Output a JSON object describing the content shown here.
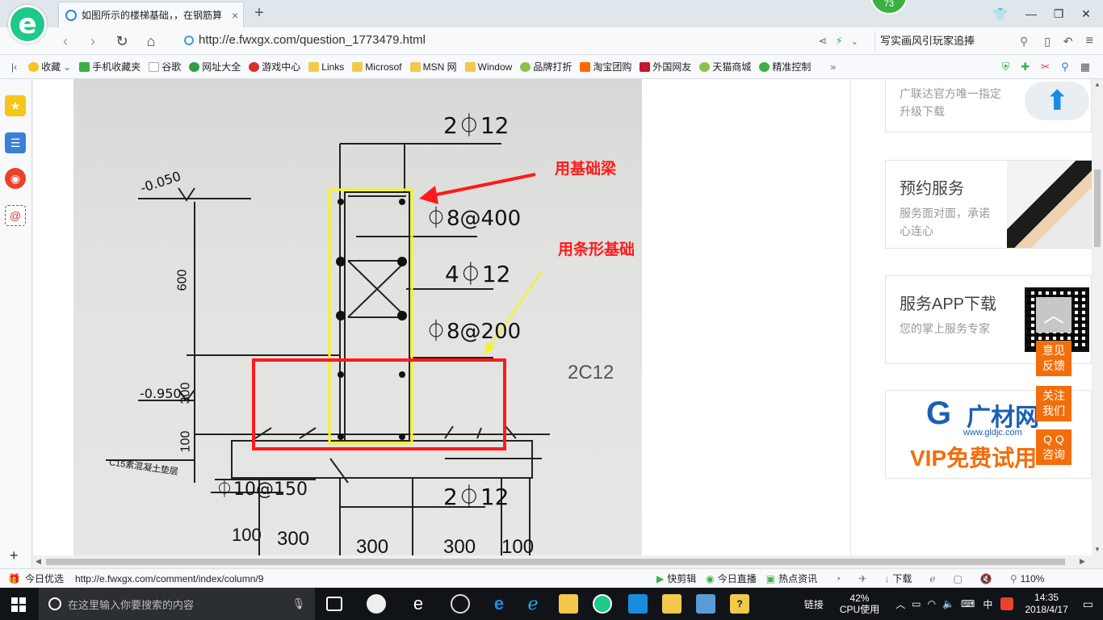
{
  "tab": {
    "title": "如图所示的楼梯基础，，在钢筋算",
    "close": "×",
    "new": "+"
  },
  "badge": "73",
  "window": {
    "tshirt": "👕",
    "minimize": "—",
    "restore": "❐",
    "close": "✕"
  },
  "address": {
    "url": "http://e.fwxgx.com/question_1773479.html",
    "search_text": "写实画风引玩家追捧"
  },
  "bookmarks": [
    {
      "label": "收藏",
      "color": "#f5c518"
    },
    {
      "label": "手机收藏夹",
      "color": "#3cb043"
    },
    {
      "label": "谷歌",
      "color": "#cccccc"
    },
    {
      "label": "网址大全",
      "color": "#2f9e44"
    },
    {
      "label": "游戏中心",
      "color": "#d9302c"
    },
    {
      "label": "Links",
      "color": "#f2c94c"
    },
    {
      "label": "Microsof",
      "color": "#f2c94c"
    },
    {
      "label": "MSN 网",
      "color": "#f2c94c"
    },
    {
      "label": "Window",
      "color": "#f2c94c"
    },
    {
      "label": "品牌打折",
      "color": "#8bc34a"
    },
    {
      "label": "淘宝团购",
      "color": "#ff6a00"
    },
    {
      "label": "外国网友",
      "color": "#c0172c"
    },
    {
      "label": "天猫商城",
      "color": "#8bc34a"
    },
    {
      "label": "精准控制",
      "color": "#3cb043"
    }
  ],
  "bookmarks_more": "»",
  "drawing": {
    "labels": [
      "2⏀12",
      "⏀8@400",
      "4⏀12",
      "⏀8@200",
      "2⏀12",
      "⏀10@150"
    ],
    "elevations": [
      "-0.050",
      "-0.950"
    ],
    "dims_vertical": [
      "600",
      "300",
      "100"
    ],
    "dims_bottom": [
      "100",
      "300",
      "300",
      "300",
      "100"
    ],
    "pad": "C15素混凝土垫层",
    "annotation_beam": "用基础梁",
    "annotation_strip": "用条形基础",
    "right_text": "2C12",
    "colors": {
      "red": "#ff1a1a",
      "yellow": "#f5f51a"
    }
  },
  "side_cards": [
    {
      "title": "",
      "sub": "广联达官方唯一指定升级下载"
    },
    {
      "title": "预约服务",
      "sub": "服务面对面，承诺心连心"
    },
    {
      "title": "服务APP下载",
      "sub": "您的掌上服务专家"
    },
    {
      "title": "广材网",
      "sub": "www.gldjc.com",
      "vip": "VIP免费试用"
    }
  ],
  "orange_buttons": [
    "意见反馈",
    "关注我们",
    "Q Q 咨询"
  ],
  "status": {
    "left_label": "今日优选",
    "url": "http://e.fwxgx.com/comment/index/column/9",
    "items": [
      "快剪辑",
      "今日直播",
      "热点资讯",
      "下载"
    ],
    "zoom": "110%"
  },
  "taskbar": {
    "search_placeholder": "在这里输入你要搜索的内容",
    "link": "链接",
    "cpu_pct": "42%",
    "cpu_label": "CPU使用",
    "ime": "中",
    "time": "14:35",
    "date": "2018/4/17"
  }
}
